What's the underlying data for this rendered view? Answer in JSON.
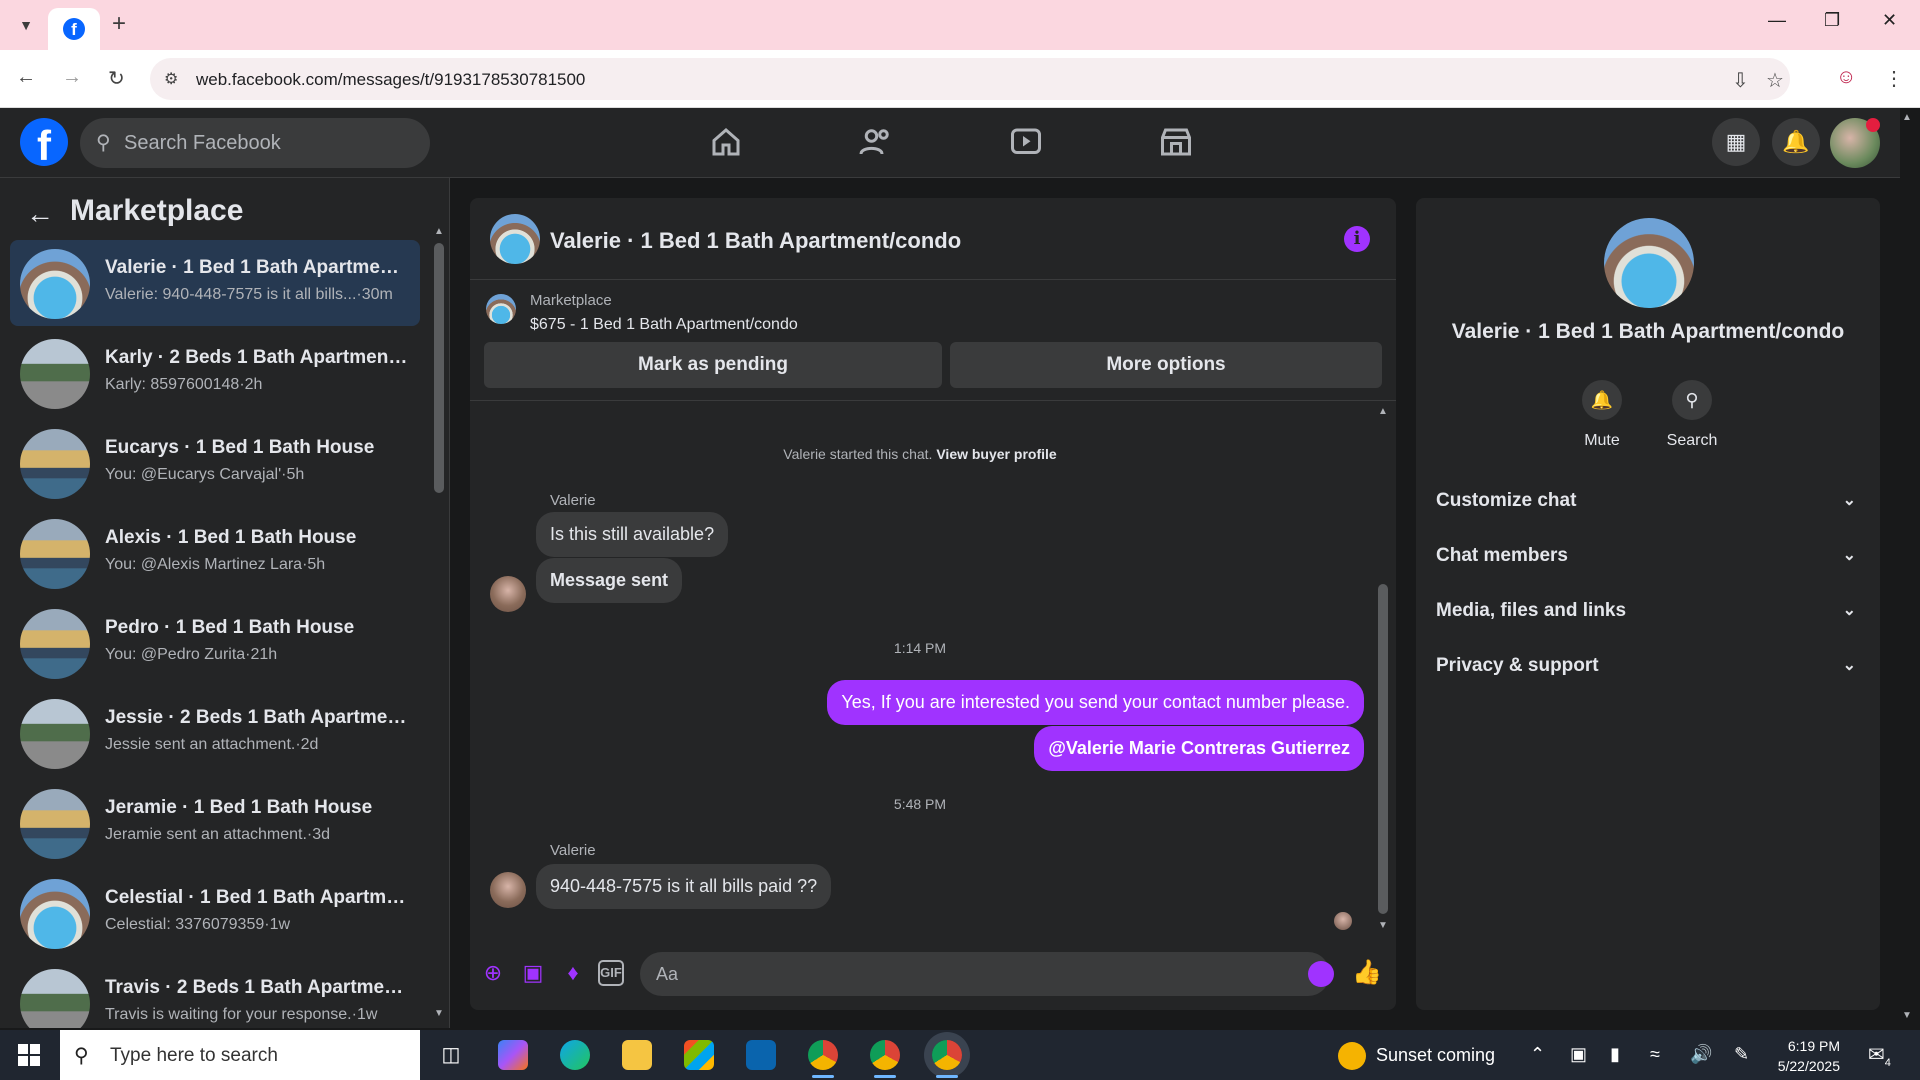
{
  "browser": {
    "url": "web.facebook.com/messages/t/9193178530781500"
  },
  "header": {
    "search_placeholder": "Search Facebook"
  },
  "sidebar": {
    "title": "Marketplace",
    "conversations": [
      {
        "name": "Valerie · 1 Bed 1 Bath Apartment...",
        "preview": "Valerie: 940-448-7575 is it all bills...·30m",
        "thumb": "pool"
      },
      {
        "name": "Karly · 2 Beds 1 Bath Apartment/...",
        "preview": "Karly: 8597600148·2h",
        "thumb": "street"
      },
      {
        "name": "Eucarys · 1 Bed 1 Bath House",
        "preview": "You: @Eucarys Carvajal'·5h",
        "thumb": "house"
      },
      {
        "name": "Alexis · 1 Bed 1 Bath House",
        "preview": "You: @Alexis Martinez Lara·5h",
        "thumb": "house"
      },
      {
        "name": "Pedro · 1 Bed 1 Bath House",
        "preview": "You: @Pedro Zurita·21h",
        "thumb": "house"
      },
      {
        "name": "Jessie · 2 Beds 1 Bath Apartment...",
        "preview": "Jessie sent an attachment.·2d",
        "thumb": "street"
      },
      {
        "name": "Jeramie · 1 Bed 1 Bath House",
        "preview": "Jeramie sent an attachment.·3d",
        "thumb": "house"
      },
      {
        "name": "Celestial · 1 Bed 1 Bath Apartme...",
        "preview": "Celestial: 3376079359·1w",
        "thumb": "pool"
      },
      {
        "name": "Travis · 2 Beds 1 Bath Apartment...",
        "preview": "Travis is waiting for your response.·1w",
        "thumb": "street"
      }
    ]
  },
  "chat": {
    "title": "Valerie · 1 Bed 1 Bath Apartment/condo",
    "marketplace_label": "Marketplace",
    "listing": "$675 - 1 Bed 1 Bath Apartment/condo",
    "mark_pending": "Mark as pending",
    "more_options": "More options",
    "system_text": "Valerie started this chat.",
    "view_buyer": "View buyer profile",
    "sender1": "Valerie",
    "msg1": "Is this still available?",
    "msg2": "Message sent",
    "time1": "1:14 PM",
    "out1": "Yes, If you are interested you send your contact number please.",
    "out2": "@Valerie Marie Contreras Gutierrez",
    "time2": "5:48 PM",
    "sender2": "Valerie",
    "msg3": "940-448-7575 is it all bills paid ??",
    "composer_placeholder": "Aa",
    "gif_label": "GIF"
  },
  "details": {
    "title": "Valerie · 1 Bed 1 Bath Apartment/condo",
    "mute_label": "Mute",
    "search_label": "Search",
    "sections": [
      "Customize chat",
      "Chat members",
      "Media, files and links",
      "Privacy & support"
    ]
  },
  "taskbar": {
    "search_placeholder": "Type here to search",
    "weather": "Sunset coming",
    "time": "6:19 PM",
    "date": "5/22/2025",
    "notification_count": "4"
  },
  "colors": {
    "accent": "#a033ff",
    "fb_blue": "#0866ff",
    "tabbar": "#fbd7e0"
  }
}
